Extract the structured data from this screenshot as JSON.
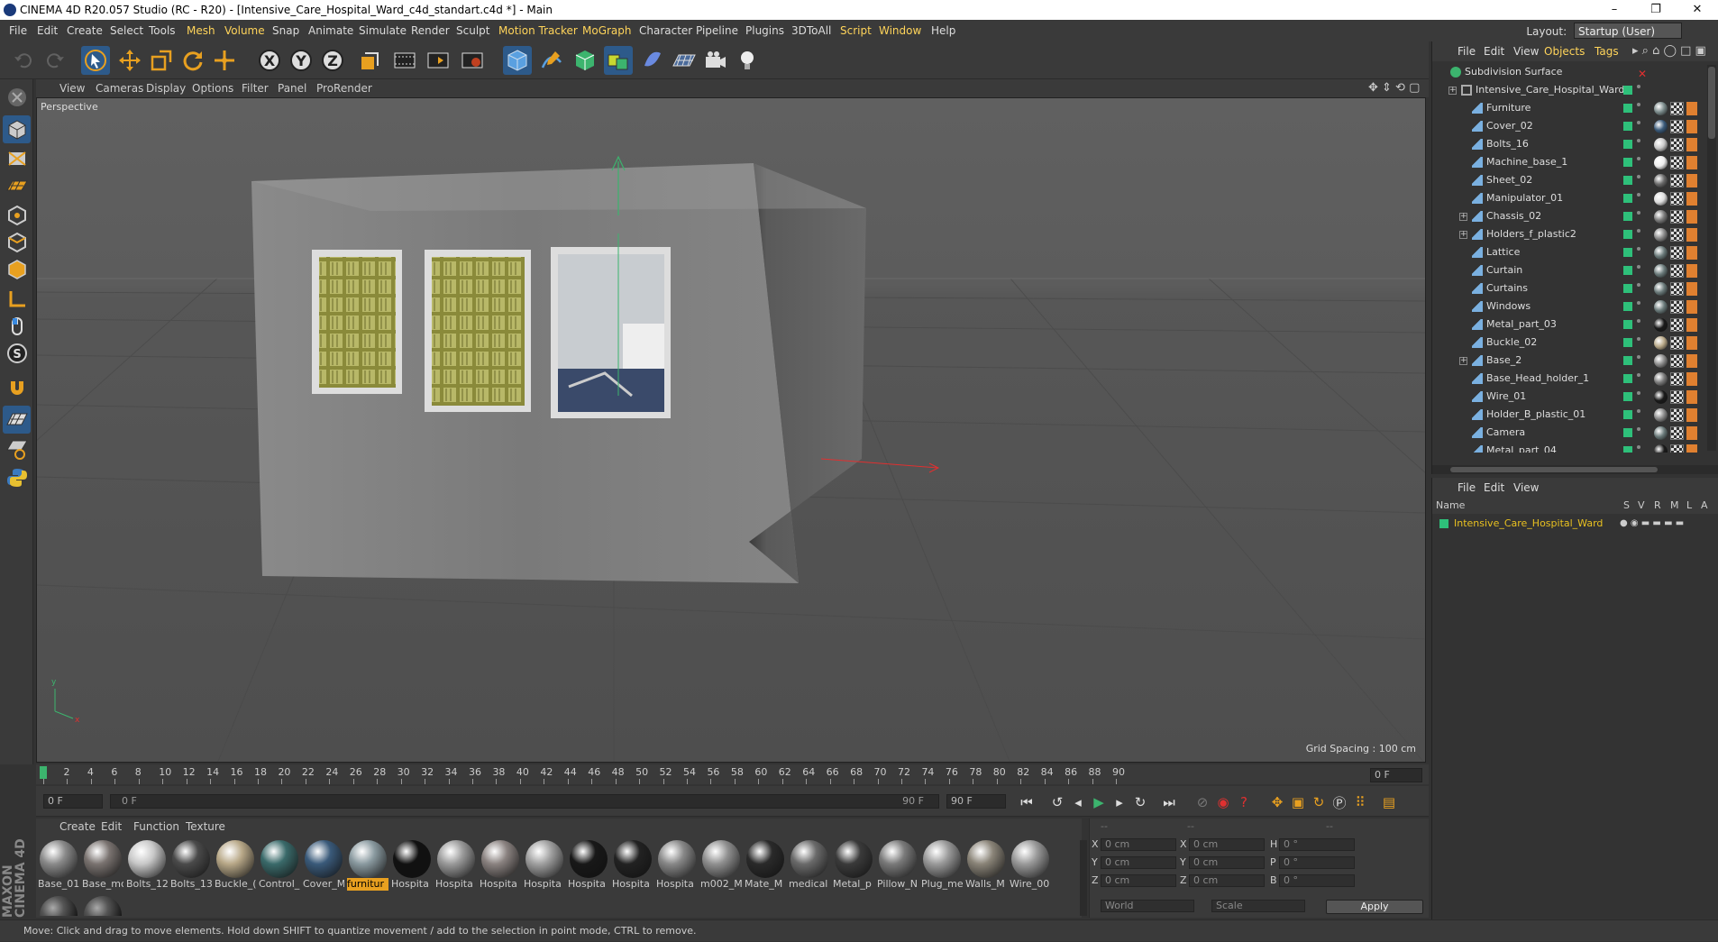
{
  "window": {
    "title": "CINEMA 4D R20.057 Studio (RC - R20) - [Intensive_Care_Hospital_Ward_c4d_standart.c4d *] - Main",
    "minimize": "–",
    "maximize": "❐",
    "close": "✕"
  },
  "menu": {
    "items": [
      "File",
      "Edit",
      "Create",
      "Select",
      "Tools",
      "Mesh",
      "Volume",
      "Snap",
      "Animate",
      "Simulate",
      "Render",
      "Sculpt",
      "Motion Tracker",
      "MoGraph",
      "Character",
      "Pipeline",
      "Plugins",
      "3DToAll",
      "Script",
      "Window",
      "Help"
    ],
    "layout_label": "Layout:",
    "layout_value": "Startup (User)"
  },
  "viewport": {
    "menu": [
      "View",
      "Cameras",
      "Display",
      "Options",
      "Filter",
      "Panel",
      "ProRender"
    ],
    "camera_label": "Perspective",
    "grid_spacing": "Grid Spacing : 100 cm"
  },
  "timeline": {
    "ticks": [
      "0",
      "2",
      "4",
      "6",
      "8",
      "10",
      "12",
      "14",
      "16",
      "18",
      "20",
      "22",
      "24",
      "26",
      "28",
      "30",
      "32",
      "34",
      "36",
      "38",
      "40",
      "42",
      "44",
      "46",
      "48",
      "50",
      "52",
      "54",
      "56",
      "58",
      "60",
      "62",
      "64",
      "66",
      "68",
      "70",
      "72",
      "74",
      "76",
      "78",
      "80",
      "82",
      "84",
      "86",
      "88",
      "90"
    ],
    "current_frame": "0 F",
    "start_frame": "0 F",
    "range_start": "0 F",
    "range_end": "90 F",
    "end_frame": "90 F"
  },
  "materials": {
    "menu": [
      "Create",
      "Edit",
      "Function",
      "Texture"
    ],
    "items": [
      {
        "label": "Base_01",
        "color": "#8a8a8a"
      },
      {
        "label": "Base_mc",
        "color": "#7a7370"
      },
      {
        "label": "Bolts_12",
        "color": "#c8c8c8"
      },
      {
        "label": "Bolts_13",
        "color": "#4a4a4a"
      },
      {
        "label": "Buckle_(",
        "color": "#b8a888"
      },
      {
        "label": "Control_",
        "color": "#3a6a6a"
      },
      {
        "label": "Cover_M",
        "color": "#3a5a7a"
      },
      {
        "label": "furnitur",
        "color": "#8a9aa0"
      },
      {
        "label": "Hospita",
        "color": "#111111"
      },
      {
        "label": "Hospita",
        "color": "#9a9a9a"
      },
      {
        "label": "Hospita",
        "color": "#8a8280"
      },
      {
        "label": "Hospita",
        "color": "#a0a0a0"
      },
      {
        "label": "Hospita",
        "color": "#181818"
      },
      {
        "label": "Hospita",
        "color": "#222222"
      },
      {
        "label": "Hospita",
        "color": "#888888"
      },
      {
        "label": "m002_M",
        "color": "#909090"
      },
      {
        "label": "Mate_M",
        "color": "#2a2a2a"
      },
      {
        "label": "medical",
        "color": "#6a6a6a"
      },
      {
        "label": "Metal_p",
        "color": "#3a3a3a"
      },
      {
        "label": "Pillow_N",
        "color": "#7a7a7a"
      },
      {
        "label": "Plug_me",
        "color": "#9a9a9a"
      },
      {
        "label": "Walls_M",
        "color": "#8a8478"
      },
      {
        "label": "Wire_00",
        "color": "#9a9a9a"
      }
    ],
    "selected_index": 7
  },
  "coordinates": {
    "rows": [
      {
        "a": "X",
        "av": "0 cm",
        "b": "X",
        "bv": "0 cm",
        "c": "H",
        "cv": "0 °"
      },
      {
        "a": "Y",
        "av": "0 cm",
        "b": "Y",
        "bv": "0 cm",
        "c": "P",
        "cv": "0 °"
      },
      {
        "a": "Z",
        "av": "0 cm",
        "b": "Z",
        "bv": "0 cm",
        "c": "B",
        "cv": "0 °"
      }
    ],
    "mode": "World",
    "transform": "Scale",
    "apply": "Apply",
    "header_dashes": [
      "--",
      "--",
      "--"
    ]
  },
  "objects": {
    "menu": [
      "File",
      "Edit",
      "View",
      "Objects",
      "Tags"
    ],
    "rows": [
      {
        "name": "Subdivision Surface",
        "level": 0,
        "expand": false,
        "tag": "none"
      },
      {
        "name": "Intensive_Care_Hospital_Ward",
        "level": 1,
        "expand": true,
        "tag": "none"
      },
      {
        "name": "Furniture",
        "level": 2,
        "expand": false,
        "tag": "#7a8a8a"
      },
      {
        "name": "Cover_02",
        "level": 2,
        "expand": false,
        "tag": "#3a5a7a"
      },
      {
        "name": "Bolts_16",
        "level": 2,
        "expand": false,
        "tag": "#c8c8c8"
      },
      {
        "name": "Machine_base_1",
        "level": 2,
        "expand": false,
        "tag": "#eeeeee"
      },
      {
        "name": "Sheet_02",
        "level": 2,
        "expand": false,
        "tag": "#6a6a6a"
      },
      {
        "name": "Manipulator_01",
        "level": 2,
        "expand": false,
        "tag": "#dddddd"
      },
      {
        "name": "Chassis_02",
        "level": 2,
        "expand": true,
        "tag": "#7a7a7a"
      },
      {
        "name": "Holders_f_plastic2",
        "level": 2,
        "expand": true,
        "tag": "#8a8a8a"
      },
      {
        "name": "Lattice",
        "level": 2,
        "expand": false,
        "tag": "#6a7a7a"
      },
      {
        "name": "Curtain",
        "level": 2,
        "expand": false,
        "tag": "#6a7a7a"
      },
      {
        "name": "Curtains",
        "level": 2,
        "expand": false,
        "tag": "#6a7a7a"
      },
      {
        "name": "Windows",
        "level": 2,
        "expand": false,
        "tag": "#6a7a7a"
      },
      {
        "name": "Metal_part_03",
        "level": 2,
        "expand": false,
        "tag": "#1a1a1a"
      },
      {
        "name": "Buckle_02",
        "level": 2,
        "expand": false,
        "tag": "#b8a888"
      },
      {
        "name": "Base_2",
        "level": 2,
        "expand": true,
        "tag": "#8a8a8a"
      },
      {
        "name": "Base_Head_holder_1",
        "level": 2,
        "expand": false,
        "tag": "#7a7a7a"
      },
      {
        "name": "Wire_01",
        "level": 2,
        "expand": false,
        "tag": "#1a1a1a"
      },
      {
        "name": "Holder_B_plastic_01",
        "level": 2,
        "expand": false,
        "tag": "#8a8a8a"
      },
      {
        "name": "Camera",
        "level": 2,
        "expand": false,
        "tag": "#6a7a7a"
      },
      {
        "name": "Metal_part_04",
        "level": 2,
        "expand": false,
        "tag": "#1a1a1a"
      }
    ]
  },
  "attributes": {
    "menu": [
      "File",
      "Edit",
      "View"
    ],
    "columns": [
      "Name",
      "S",
      "V",
      "R",
      "M",
      "L",
      "A"
    ],
    "row_name": "Intensive_Care_Hospital_Ward"
  },
  "status": "Move: Click and drag to move elements. Hold down SHIFT to quantize movement / add to the selection in point mode, CTRL to remove.",
  "brand": "MAXON CINEMA 4D"
}
